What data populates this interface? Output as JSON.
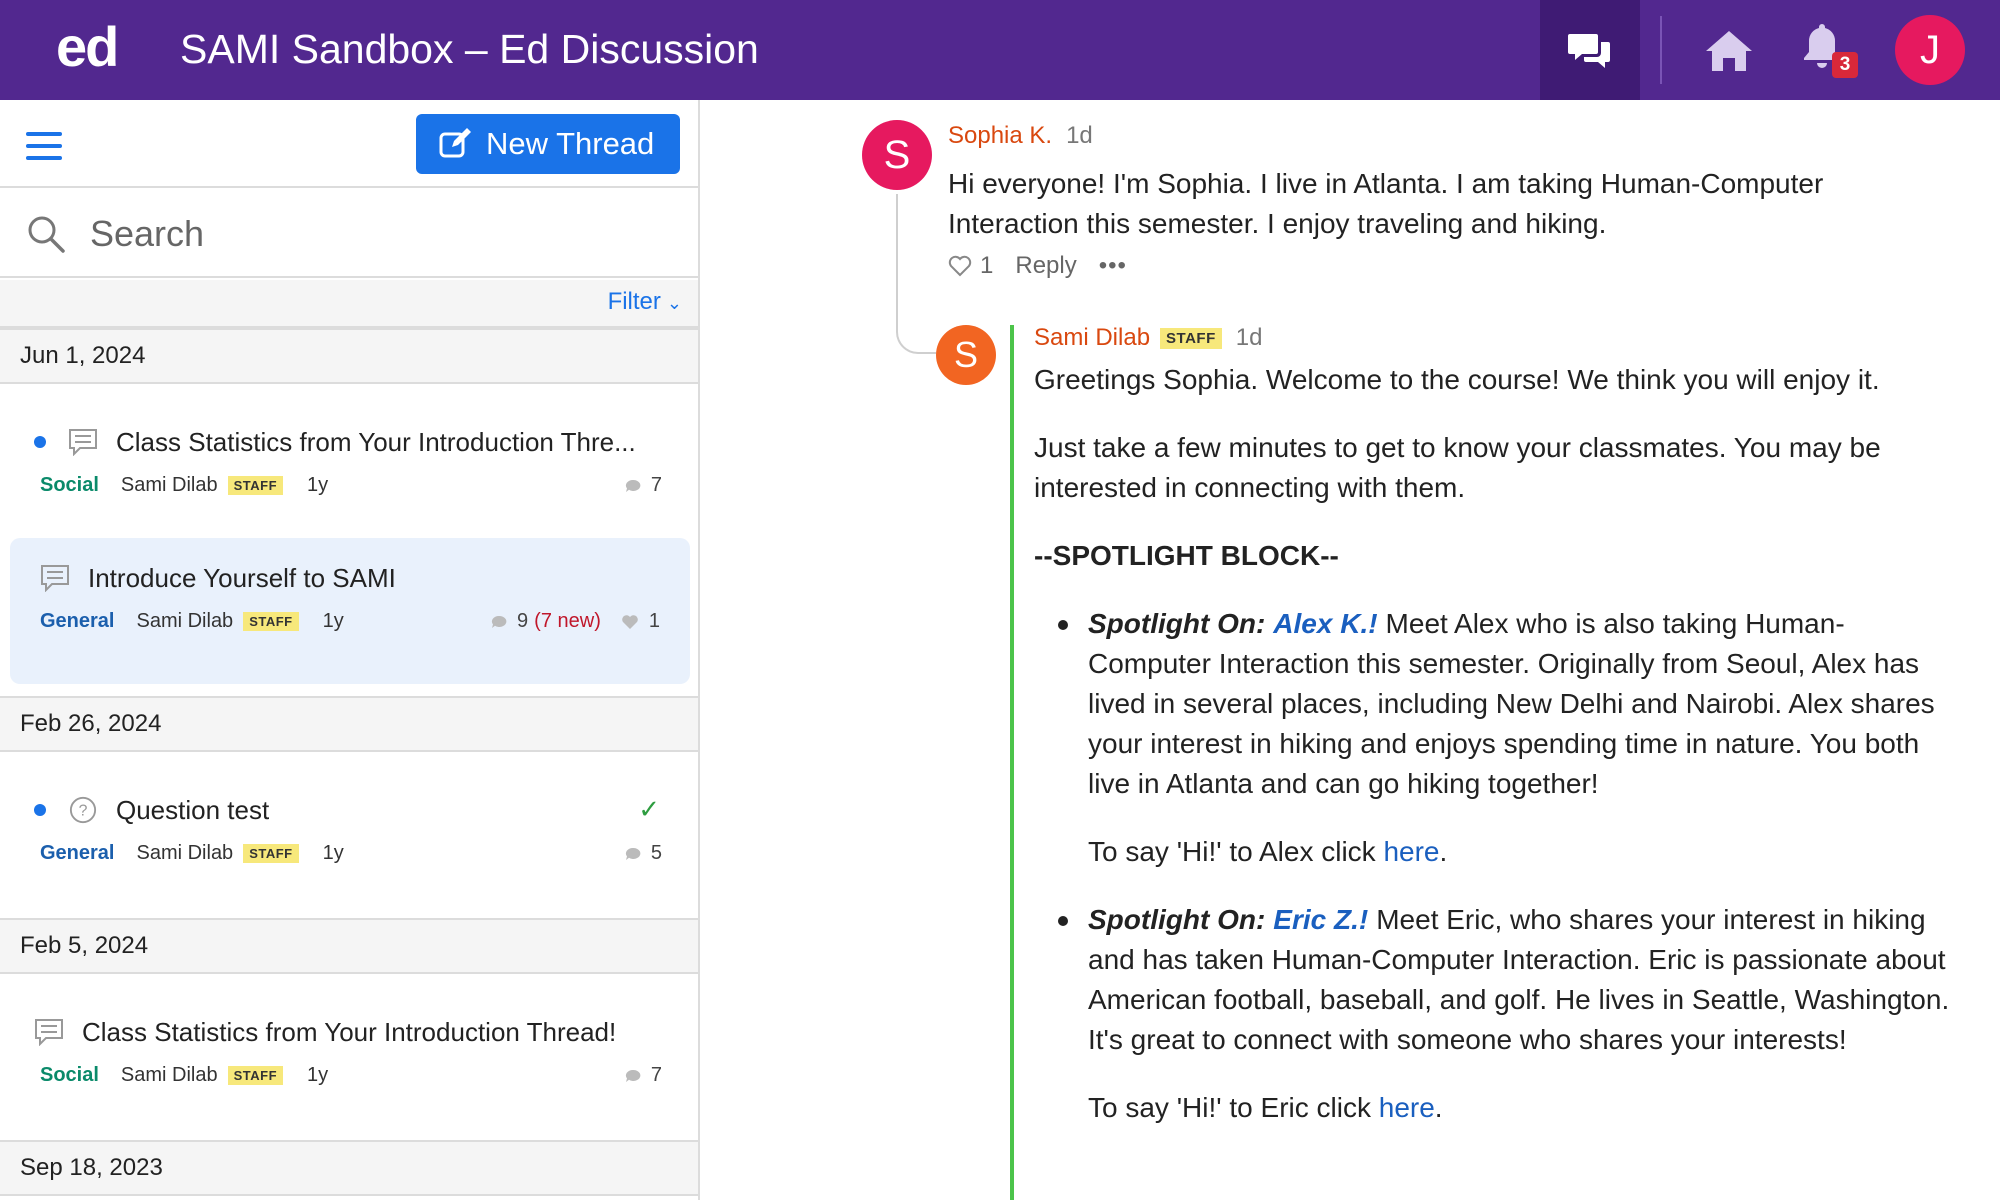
{
  "header": {
    "logo": "ed",
    "course_title": "SAMI Sandbox – Ed Discussion",
    "notification_count": "3",
    "user_initial": "J"
  },
  "sidebar": {
    "new_thread_label": "New Thread",
    "search_placeholder": "Search",
    "filter_label": "Filter",
    "groups": [
      {
        "date": "Jun 1, 2024",
        "threads": [
          {
            "title": "Class Statistics from Your Introduction Thre...",
            "category": "Social",
            "author": "Sami Dilab",
            "badge": "STAFF",
            "age": "1y",
            "comments": "7"
          },
          {
            "title": "Introduce Yourself to SAMI",
            "category": "General",
            "author": "Sami Dilab",
            "badge": "STAFF",
            "age": "1y",
            "comments": "9",
            "new": "(7 new)",
            "likes": "1"
          }
        ]
      },
      {
        "date": "Feb 26, 2024",
        "threads": [
          {
            "title": "Question test",
            "category": "General",
            "author": "Sami Dilab",
            "badge": "STAFF",
            "age": "1y",
            "comments": "5"
          }
        ]
      },
      {
        "date": "Feb 5, 2024",
        "threads": [
          {
            "title": "Class Statistics from Your Introduction Thread!",
            "category": "Social",
            "author": "Sami Dilab",
            "badge": "STAFF",
            "age": "1y",
            "comments": "7"
          }
        ]
      },
      {
        "date": "Sep 18, 2023",
        "threads": []
      }
    ]
  },
  "post": {
    "author_initial": "S",
    "author": "Sophia K.",
    "age": "1d",
    "body": "Hi everyone! I'm Sophia. I live in Atlanta. I am taking Human-Computer Interaction this semester. I enjoy traveling and hiking.",
    "likes": "1",
    "reply_label": "Reply",
    "more_label": "•••"
  },
  "reply": {
    "author_initial": "S",
    "author": "Sami Dilab",
    "badge": "STAFF",
    "age": "1d",
    "p1": "Greetings Sophia. Welcome to the course! We think you will enjoy it.",
    "p2": "Just take a few minutes to get to know your classmates. You may be interested in connecting with them.",
    "block_title": "--SPOTLIGHT BLOCK--",
    "spotlights": [
      {
        "label": "Spotlight On:",
        "name": "Alex K.!",
        "text": "Meet Alex who is also taking Human-Computer Interaction this semester. Originally from Seoul, Alex has lived in several places, including New Delhi and Nairobi. Alex shares your interest in hiking and enjoys spending time in nature. You both live in Atlanta and can go hiking together!",
        "say_prefix": "To say 'Hi!' to Alex click ",
        "link": "here",
        "say_suffix": "."
      },
      {
        "label": "Spotlight On:",
        "name": "Eric Z.!",
        "text": "Meet Eric, who shares your interest in hiking and has taken Human-Computer Interaction. Eric is passionate about American football, baseball, and golf. He lives in Seattle, Washington. It's great to connect with someone who shares your interests!",
        "say_prefix": "To say 'Hi!' to Eric click ",
        "link": "here",
        "say_suffix": "."
      }
    ]
  },
  "colors": {
    "topbar": "#52288f",
    "accent": "#1a73e8",
    "staff_badge": "#f7e87b",
    "reply_bar": "#4cc44a",
    "sophia_avatar": "#e6195f",
    "sami_avatar": "#f26522"
  },
  "icons": [
    "discussion-icon",
    "home-icon",
    "bell-icon",
    "hamburger-icon",
    "edit-icon",
    "search-icon",
    "chevron-down-icon",
    "thread-icon",
    "question-icon",
    "check-icon",
    "comment-icon",
    "heart-icon"
  ]
}
